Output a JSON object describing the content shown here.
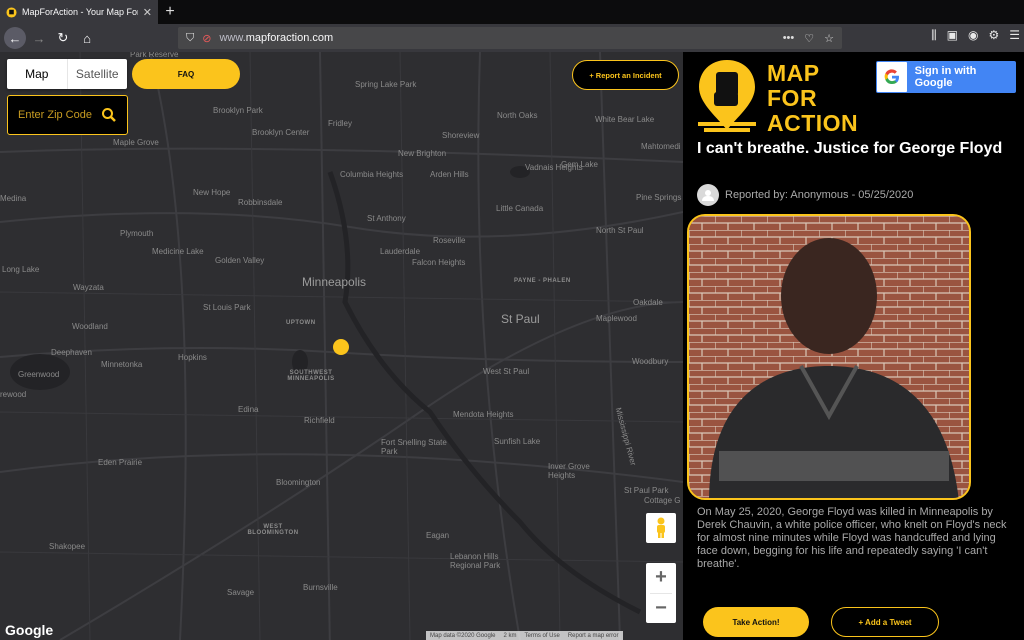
{
  "browser": {
    "tab_title": "MapForAction - Your Map For C",
    "url_host": "www.",
    "url_domain": "mapforaction.com"
  },
  "map": {
    "type_map": "Map",
    "type_satellite": "Satellite",
    "faq_label": "FAQ",
    "zip_placeholder": "Enter Zip Code",
    "report_label": "+ Report an Incident",
    "google_logo": "Google",
    "attribution": [
      "Map data ©2020 Google",
      "2 km",
      "Terms of Use",
      "Report a map error"
    ],
    "labels": [
      {
        "text": "Park Reserve",
        "cls": ""
      },
      {
        "text": "Spring Lake Park",
        "cls": ""
      },
      {
        "text": "Brooklyn Park",
        "cls": ""
      },
      {
        "text": "North Oaks",
        "cls": ""
      },
      {
        "text": "White Bear Lake",
        "cls": ""
      },
      {
        "text": "Fridley",
        "cls": ""
      },
      {
        "text": "Maple Grove",
        "cls": ""
      },
      {
        "text": "Brooklyn Center",
        "cls": ""
      },
      {
        "text": "Shoreview",
        "cls": ""
      },
      {
        "text": "Mahtomedi",
        "cls": ""
      },
      {
        "text": "New Brighton",
        "cls": ""
      },
      {
        "text": "Gem Lake",
        "cls": ""
      },
      {
        "text": "Vadnais Heights",
        "cls": ""
      },
      {
        "text": "Columbia Heights",
        "cls": ""
      },
      {
        "text": "Arden Hills",
        "cls": ""
      },
      {
        "text": "New Hope",
        "cls": ""
      },
      {
        "text": "Robbinsdale",
        "cls": ""
      },
      {
        "text": "Medina",
        "cls": ""
      },
      {
        "text": "Little Canada",
        "cls": ""
      },
      {
        "text": "Pine Springs",
        "cls": ""
      },
      {
        "text": "St Anthony",
        "cls": ""
      },
      {
        "text": "Plymouth",
        "cls": ""
      },
      {
        "text": "Roseville",
        "cls": ""
      },
      {
        "text": "North St Paul",
        "cls": ""
      },
      {
        "text": "Medicine Lake",
        "cls": ""
      },
      {
        "text": "Lauderdale",
        "cls": ""
      },
      {
        "text": "Golden Valley",
        "cls": ""
      },
      {
        "text": "Falcon Heights",
        "cls": ""
      },
      {
        "text": "Long Lake",
        "cls": ""
      },
      {
        "text": "Minneapolis",
        "cls": "big"
      },
      {
        "text": "PAYNE - PHALEN",
        "cls": "caps"
      },
      {
        "text": "Wayzata",
        "cls": ""
      },
      {
        "text": "Oakdale",
        "cls": ""
      },
      {
        "text": "St Louis Park",
        "cls": ""
      },
      {
        "text": "St Paul",
        "cls": "big"
      },
      {
        "text": "UPTOWN",
        "cls": "caps"
      },
      {
        "text": "Woodland",
        "cls": ""
      },
      {
        "text": "Maplewood",
        "cls": ""
      },
      {
        "text": "Deephaven",
        "cls": ""
      },
      {
        "text": "Hopkins",
        "cls": ""
      },
      {
        "text": "Minnetonka",
        "cls": ""
      },
      {
        "text": "Woodbury",
        "cls": ""
      },
      {
        "text": "Greenwood",
        "cls": ""
      },
      {
        "text": "SOUTHWEST MINNEAPOLIS",
        "cls": "caps"
      },
      {
        "text": "West St Paul",
        "cls": ""
      },
      {
        "text": "rewood",
        "cls": ""
      },
      {
        "text": "Edina",
        "cls": ""
      },
      {
        "text": "Richfield",
        "cls": ""
      },
      {
        "text": "Mendota Heights",
        "cls": ""
      },
      {
        "text": "Fort Snelling State Park",
        "cls": ""
      },
      {
        "text": "Sunfish Lake",
        "cls": ""
      },
      {
        "text": "Eden Prairie",
        "cls": ""
      },
      {
        "text": "Inver Grove Heights",
        "cls": ""
      },
      {
        "text": "Bloomington",
        "cls": ""
      },
      {
        "text": "St Paul Park",
        "cls": ""
      },
      {
        "text": "Cottage G",
        "cls": ""
      },
      {
        "text": "WEST BLOOMINGTON",
        "cls": "caps"
      },
      {
        "text": "Eagan",
        "cls": ""
      },
      {
        "text": "Shakopee",
        "cls": ""
      },
      {
        "text": "Lebanon Hills Regional Park",
        "cls": ""
      },
      {
        "text": "Burnsville",
        "cls": ""
      },
      {
        "text": "Savage",
        "cls": ""
      },
      {
        "text": "Mississippi River",
        "cls": ""
      }
    ]
  },
  "panel": {
    "logo_line1": "MAP",
    "logo_line2": "FOR",
    "logo_line3": "ACTION",
    "google_signin": "Sign in with Google",
    "title": "I can't breathe. Justice for George Floyd",
    "reporter": "Reported by: Anonymous  -  05/25/2020",
    "description": "On May 25, 2020, George Floyd was killed in Minneapolis by Derek Chauvin, a white police officer, who knelt on Floyd's neck for almost nine minutes while Floyd was handcuffed and lying face down, begging for his life and repeatedly saying 'I can't breathe'.",
    "take_action": "Take Action!",
    "add_tweet": "+ Add a Tweet"
  },
  "colors": {
    "accent": "#fbc41c",
    "map_bg": "#2e2e31",
    "google_blue": "#4285f4"
  }
}
